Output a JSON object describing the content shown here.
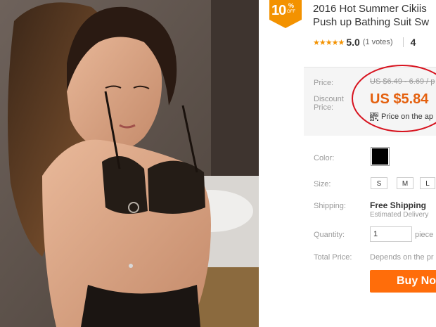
{
  "product": {
    "title_line1": "2016 Hot Summer Cikiis",
    "title_line2": "Push up Bathing Suit Sw"
  },
  "badge": {
    "percent": "10",
    "percent_sign": "%",
    "off": "OFF"
  },
  "rating": {
    "stars": "★★★★★",
    "value": "5.0",
    "votes": "(1 votes)",
    "orders_partial": "4"
  },
  "price": {
    "price_label": "Price:",
    "old_price": "US $6.49 - 6.69 / p",
    "discount_label_line1": "Discount",
    "discount_label_line2": "Price:",
    "discount_price": "US $5.84",
    "app_price_text": "Price on the ap"
  },
  "options": {
    "color_label": "Color:",
    "color_swatch": "#000000",
    "size_label": "Size:",
    "sizes": [
      "S",
      "M",
      "L"
    ],
    "shipping_label": "Shipping:",
    "shipping_title": "Free Shipping",
    "shipping_sub": "Estimated Delivery",
    "quantity_label": "Quantity:",
    "quantity_value": "1",
    "quantity_unit": "piece",
    "total_label": "Total Price:",
    "total_value": "Depends on the pr"
  },
  "actions": {
    "buy_now": "Buy No"
  },
  "colors": {
    "accent": "#e4600e",
    "buy_button": "#ff6d0a",
    "badge": "#f39200",
    "annotation": "#d7121e"
  }
}
